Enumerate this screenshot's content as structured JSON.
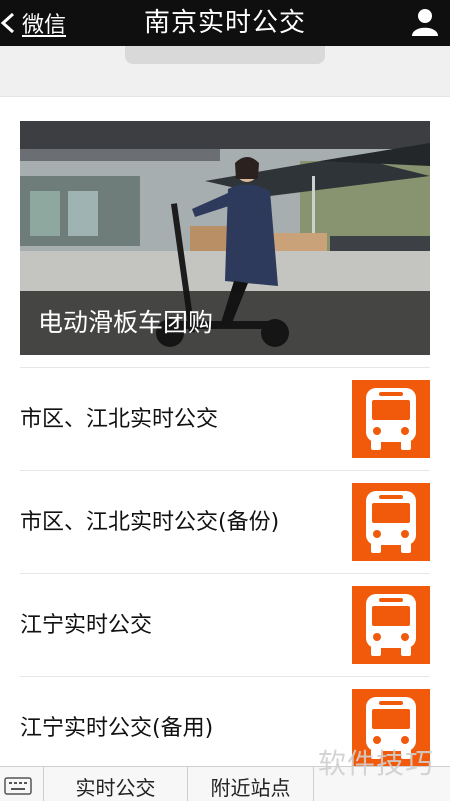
{
  "header": {
    "back_label": "微信",
    "title": "南京实时公交"
  },
  "banner": {
    "caption": "电动滑板车团购"
  },
  "menu": {
    "items": [
      {
        "label": "市区、江北实时公交"
      },
      {
        "label": "市区、江北实时公交(备份)"
      },
      {
        "label": "江宁实时公交"
      },
      {
        "label": "江宁实时公交(备用)"
      }
    ]
  },
  "tabbar": {
    "tabs": [
      {
        "label": "实时公交"
      },
      {
        "label": "附近站点"
      }
    ]
  },
  "watermark": "软件技巧",
  "colors": {
    "topbar": "#0f0f0f",
    "bus_icon_bg": "#f05a0a",
    "icon_fg": "#ffffff"
  },
  "icons": {
    "back": "chevron-left-icon",
    "profile": "person-icon",
    "bus": "bus-icon",
    "keyboard": "keyboard-icon"
  }
}
